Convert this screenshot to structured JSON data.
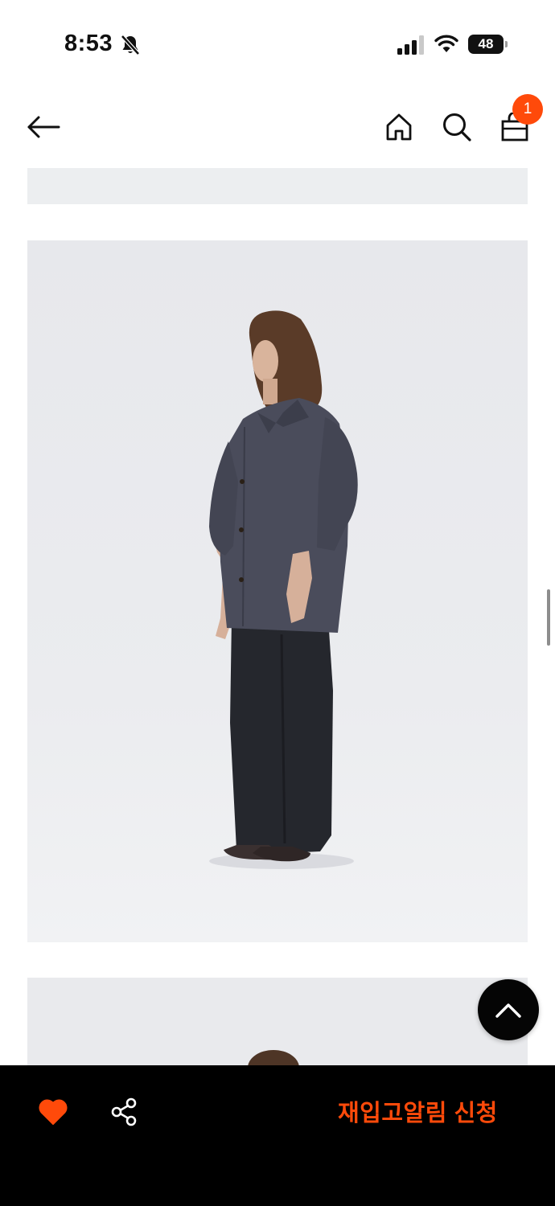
{
  "status_bar": {
    "time": "8:53",
    "battery_level": "48",
    "icons": [
      "bell-slash-icon",
      "cellular-signal-icon",
      "wifi-icon",
      "battery-icon"
    ]
  },
  "nav": {
    "icons": [
      "back-arrow-icon",
      "home-icon",
      "search-icon",
      "shopping-bag-icon"
    ],
    "cart_count": "1"
  },
  "floating": {
    "icon": "chevron-up-icon"
  },
  "bottom_bar": {
    "like_icon": "heart-icon",
    "share_icon": "share-icon",
    "restock_label": "재입고알림 신청"
  },
  "colors": {
    "accent": "#ff4a0a",
    "bottom_bar": "#000000",
    "photo_background": "#e9eaed"
  }
}
